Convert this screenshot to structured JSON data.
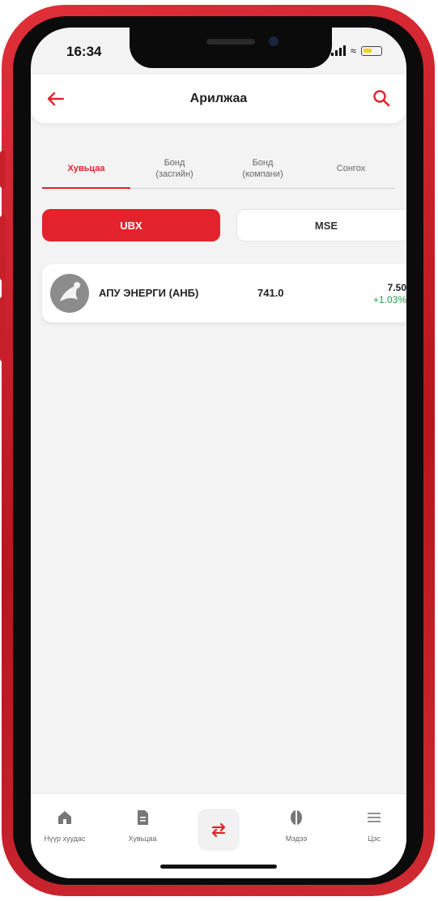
{
  "status_bar": {
    "time": "16:34"
  },
  "header": {
    "title": "Арилжаа"
  },
  "tabs": [
    {
      "label": "Хувьцаа",
      "active": true
    },
    {
      "label": "Бонд (засгийн)",
      "active": false
    },
    {
      "label": "Бонд (компани)",
      "active": false
    },
    {
      "label": "Сонгох",
      "active": false
    }
  ],
  "exchanges": {
    "primary": "UBX",
    "secondary": "MSE"
  },
  "stock_list": [
    {
      "company": "АПУ ЭНЕРГИ (АНБ)",
      "price": "741.0",
      "change": "7.50",
      "change_percent": "+1.03%"
    }
  ],
  "bottom_nav": {
    "items": [
      {
        "label": "Нүүр хуудас",
        "icon": "home-icon"
      },
      {
        "label": "Хувьцаа",
        "icon": "document-icon"
      },
      {
        "label": "",
        "icon": "trade-arrows-icon"
      },
      {
        "label": "Мэдээ",
        "icon": "news-icon"
      },
      {
        "label": "Цэс",
        "icon": "menu-icon"
      }
    ]
  },
  "colors": {
    "accent": "#e2232d",
    "positive": "#1aa34a",
    "frame": "#c8202a"
  }
}
